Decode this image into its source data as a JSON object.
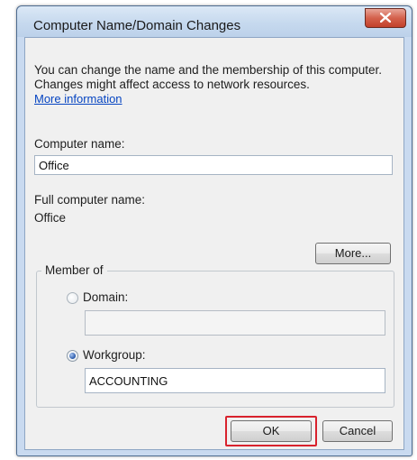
{
  "window": {
    "title": "Computer Name/Domain Changes"
  },
  "intro": {
    "text": "You can change the name and the membership of this computer. Changes might affect access to network resources.",
    "link": "More information"
  },
  "computer_name": {
    "label": "Computer name:",
    "value": "Office"
  },
  "full_name": {
    "label": "Full computer name:",
    "value": "Office"
  },
  "buttons": {
    "more": "More...",
    "ok": "OK",
    "cancel": "Cancel"
  },
  "member_of": {
    "title": "Member of",
    "domain_label": "Domain:",
    "domain_value": "",
    "domain_selected": false,
    "workgroup_label": "Workgroup:",
    "workgroup_value": "ACCOUNTING",
    "workgroup_selected": true
  },
  "colors": {
    "highlight": "#d8222d",
    "link": "#0645c2"
  },
  "icons": {
    "close": "close-icon"
  }
}
